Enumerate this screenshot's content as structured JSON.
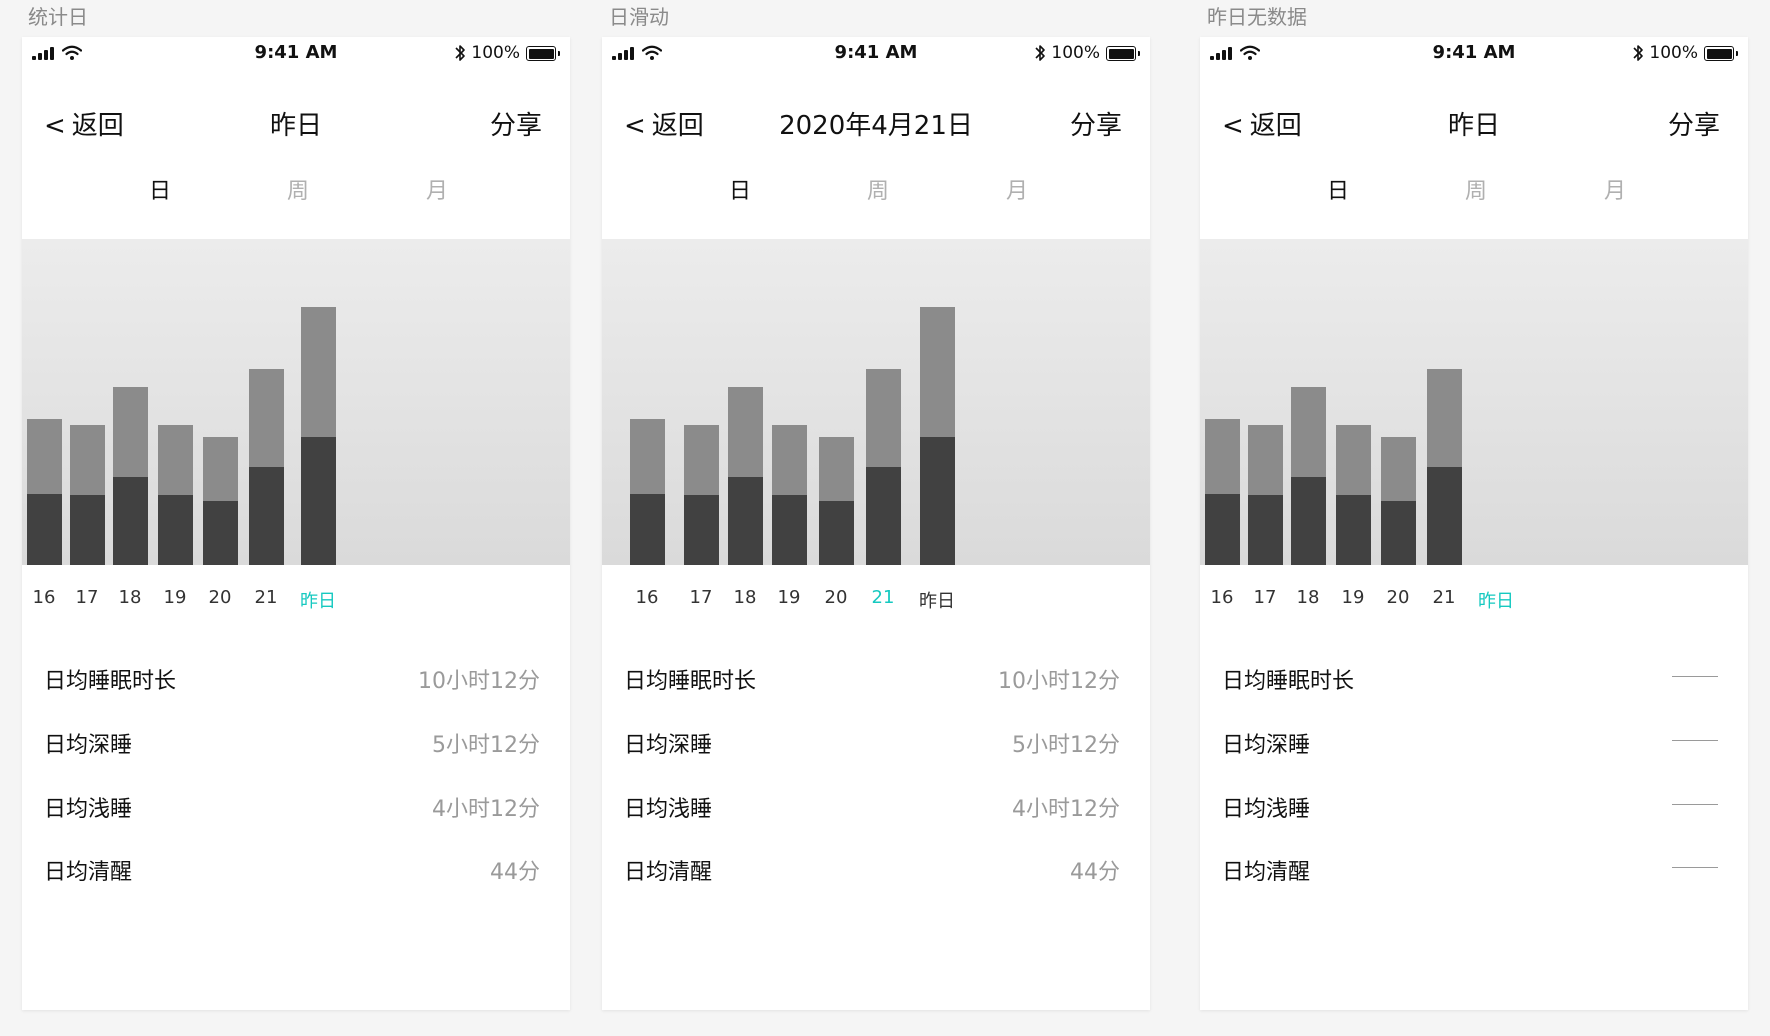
{
  "screens": [
    {
      "label": "统计日",
      "status_time": "9:41 AM",
      "battery_text": "100%",
      "back_label": "返回",
      "title": "昨日",
      "share_label": "分享",
      "tabs": [
        "日",
        "周",
        "月"
      ],
      "active_tab": 0,
      "x_labels": [
        "16",
        "17",
        "18",
        "19",
        "20",
        "21",
        "昨日"
      ],
      "highlight_index": 6,
      "stats": [
        {
          "label": "日均睡眠时长",
          "value": "10小时12分"
        },
        {
          "label": "日均深睡",
          "value": "5小时12分"
        },
        {
          "label": "日均浅睡",
          "value": "4小时12分"
        },
        {
          "label": "日均清醒",
          "value": "44分"
        }
      ]
    },
    {
      "label": "日滑动",
      "status_time": "9:41 AM",
      "battery_text": "100%",
      "back_label": "返回",
      "title": "2020年4月21日",
      "share_label": "分享",
      "tabs": [
        "日",
        "周",
        "月"
      ],
      "active_tab": 0,
      "x_labels": [
        "16",
        "17",
        "18",
        "19",
        "20",
        "21",
        "昨日"
      ],
      "highlight_index": 5,
      "stats": [
        {
          "label": "日均睡眠时长",
          "value": "10小时12分"
        },
        {
          "label": "日均深睡",
          "value": "5小时12分"
        },
        {
          "label": "日均浅睡",
          "value": "4小时12分"
        },
        {
          "label": "日均清醒",
          "value": "44分"
        }
      ]
    },
    {
      "label": "昨日无数据",
      "status_time": "9:41 AM",
      "battery_text": "100%",
      "back_label": "返回",
      "title": "昨日",
      "share_label": "分享",
      "tabs": [
        "日",
        "周",
        "月"
      ],
      "active_tab": 0,
      "x_labels": [
        "16",
        "17",
        "18",
        "19",
        "20",
        "21",
        "昨日"
      ],
      "highlight_index": 6,
      "stats": [
        {
          "label": "日均睡眠时长",
          "value": ""
        },
        {
          "label": "日均深睡",
          "value": ""
        },
        {
          "label": "日均浅睡",
          "value": ""
        },
        {
          "label": "日均清醒",
          "value": ""
        }
      ]
    }
  ],
  "chart_data": {
    "type": "bar",
    "stacked": true,
    "categories": [
      "16",
      "17",
      "18",
      "19",
      "20",
      "21",
      "昨日"
    ],
    "series": [
      {
        "values": [
          74,
          73,
          92,
          73,
          67,
          102,
          134
        ],
        "color": "#414141"
      },
      {
        "values": [
          78,
          73,
          94,
          73,
          67,
          102,
          135
        ],
        "color": "#8b8b8b"
      }
    ],
    "no_data_category": "昨日",
    "ylim": [
      0,
      340
    ]
  },
  "colors": {
    "accent": "#16c9c0",
    "bar_dark": "#414141",
    "bar_light": "#8b8b8b",
    "muted_text": "#9a9a9a"
  },
  "icons": [
    "cellular-signal-icon",
    "wifi-icon",
    "bluetooth-icon",
    "battery-icon",
    "back-chevron-icon"
  ]
}
